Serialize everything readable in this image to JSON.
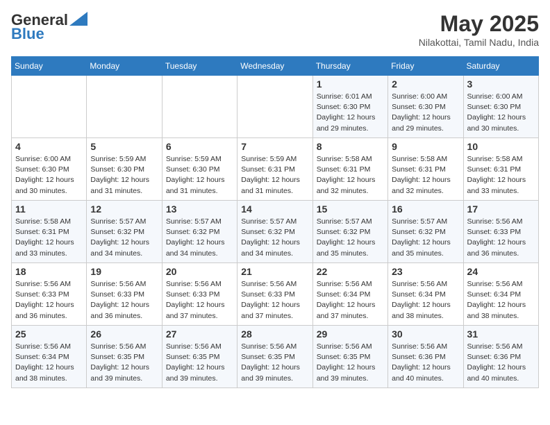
{
  "header": {
    "logo_general": "General",
    "logo_blue": "Blue",
    "month_year": "May 2025",
    "location": "Nilakottai, Tamil Nadu, India"
  },
  "weekdays": [
    "Sunday",
    "Monday",
    "Tuesday",
    "Wednesday",
    "Thursday",
    "Friday",
    "Saturday"
  ],
  "weeks": [
    [
      {
        "day": "",
        "info": ""
      },
      {
        "day": "",
        "info": ""
      },
      {
        "day": "",
        "info": ""
      },
      {
        "day": "",
        "info": ""
      },
      {
        "day": "1",
        "info": "Sunrise: 6:01 AM\nSunset: 6:30 PM\nDaylight: 12 hours\nand 29 minutes."
      },
      {
        "day": "2",
        "info": "Sunrise: 6:00 AM\nSunset: 6:30 PM\nDaylight: 12 hours\nand 29 minutes."
      },
      {
        "day": "3",
        "info": "Sunrise: 6:00 AM\nSunset: 6:30 PM\nDaylight: 12 hours\nand 30 minutes."
      }
    ],
    [
      {
        "day": "4",
        "info": "Sunrise: 6:00 AM\nSunset: 6:30 PM\nDaylight: 12 hours\nand 30 minutes."
      },
      {
        "day": "5",
        "info": "Sunrise: 5:59 AM\nSunset: 6:30 PM\nDaylight: 12 hours\nand 31 minutes."
      },
      {
        "day": "6",
        "info": "Sunrise: 5:59 AM\nSunset: 6:30 PM\nDaylight: 12 hours\nand 31 minutes."
      },
      {
        "day": "7",
        "info": "Sunrise: 5:59 AM\nSunset: 6:31 PM\nDaylight: 12 hours\nand 31 minutes."
      },
      {
        "day": "8",
        "info": "Sunrise: 5:58 AM\nSunset: 6:31 PM\nDaylight: 12 hours\nand 32 minutes."
      },
      {
        "day": "9",
        "info": "Sunrise: 5:58 AM\nSunset: 6:31 PM\nDaylight: 12 hours\nand 32 minutes."
      },
      {
        "day": "10",
        "info": "Sunrise: 5:58 AM\nSunset: 6:31 PM\nDaylight: 12 hours\nand 33 minutes."
      }
    ],
    [
      {
        "day": "11",
        "info": "Sunrise: 5:58 AM\nSunset: 6:31 PM\nDaylight: 12 hours\nand 33 minutes."
      },
      {
        "day": "12",
        "info": "Sunrise: 5:57 AM\nSunset: 6:32 PM\nDaylight: 12 hours\nand 34 minutes."
      },
      {
        "day": "13",
        "info": "Sunrise: 5:57 AM\nSunset: 6:32 PM\nDaylight: 12 hours\nand 34 minutes."
      },
      {
        "day": "14",
        "info": "Sunrise: 5:57 AM\nSunset: 6:32 PM\nDaylight: 12 hours\nand 34 minutes."
      },
      {
        "day": "15",
        "info": "Sunrise: 5:57 AM\nSunset: 6:32 PM\nDaylight: 12 hours\nand 35 minutes."
      },
      {
        "day": "16",
        "info": "Sunrise: 5:57 AM\nSunset: 6:32 PM\nDaylight: 12 hours\nand 35 minutes."
      },
      {
        "day": "17",
        "info": "Sunrise: 5:56 AM\nSunset: 6:33 PM\nDaylight: 12 hours\nand 36 minutes."
      }
    ],
    [
      {
        "day": "18",
        "info": "Sunrise: 5:56 AM\nSunset: 6:33 PM\nDaylight: 12 hours\nand 36 minutes."
      },
      {
        "day": "19",
        "info": "Sunrise: 5:56 AM\nSunset: 6:33 PM\nDaylight: 12 hours\nand 36 minutes."
      },
      {
        "day": "20",
        "info": "Sunrise: 5:56 AM\nSunset: 6:33 PM\nDaylight: 12 hours\nand 37 minutes."
      },
      {
        "day": "21",
        "info": "Sunrise: 5:56 AM\nSunset: 6:33 PM\nDaylight: 12 hours\nand 37 minutes."
      },
      {
        "day": "22",
        "info": "Sunrise: 5:56 AM\nSunset: 6:34 PM\nDaylight: 12 hours\nand 37 minutes."
      },
      {
        "day": "23",
        "info": "Sunrise: 5:56 AM\nSunset: 6:34 PM\nDaylight: 12 hours\nand 38 minutes."
      },
      {
        "day": "24",
        "info": "Sunrise: 5:56 AM\nSunset: 6:34 PM\nDaylight: 12 hours\nand 38 minutes."
      }
    ],
    [
      {
        "day": "25",
        "info": "Sunrise: 5:56 AM\nSunset: 6:34 PM\nDaylight: 12 hours\nand 38 minutes."
      },
      {
        "day": "26",
        "info": "Sunrise: 5:56 AM\nSunset: 6:35 PM\nDaylight: 12 hours\nand 39 minutes."
      },
      {
        "day": "27",
        "info": "Sunrise: 5:56 AM\nSunset: 6:35 PM\nDaylight: 12 hours\nand 39 minutes."
      },
      {
        "day": "28",
        "info": "Sunrise: 5:56 AM\nSunset: 6:35 PM\nDaylight: 12 hours\nand 39 minutes."
      },
      {
        "day": "29",
        "info": "Sunrise: 5:56 AM\nSunset: 6:35 PM\nDaylight: 12 hours\nand 39 minutes."
      },
      {
        "day": "30",
        "info": "Sunrise: 5:56 AM\nSunset: 6:36 PM\nDaylight: 12 hours\nand 40 minutes."
      },
      {
        "day": "31",
        "info": "Sunrise: 5:56 AM\nSunset: 6:36 PM\nDaylight: 12 hours\nand 40 minutes."
      }
    ]
  ]
}
